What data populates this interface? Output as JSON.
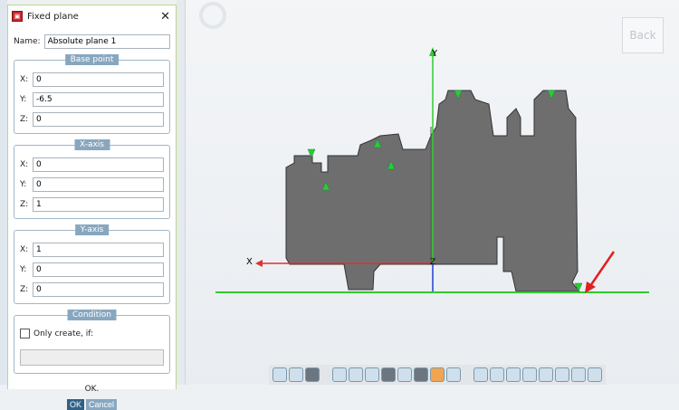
{
  "dialog": {
    "title": "Fixed plane",
    "name_label": "Name:",
    "name_value": "Absolute plane 1",
    "base_point": {
      "legend": "Base point",
      "x": "0",
      "y": "-6.5",
      "z": "0"
    },
    "x_axis": {
      "legend": "X-axis",
      "x": "0",
      "y": "0",
      "z": "1"
    },
    "y_axis": {
      "legend": "Y-axis",
      "x": "1",
      "y": "0",
      "z": "0"
    },
    "condition": {
      "legend": "Condition",
      "checkbox_label": "Only create, if:"
    },
    "status": "OK.",
    "ok": "OK",
    "cancel": "Cancel"
  },
  "labels": {
    "x": "X:",
    "y": "Y:",
    "z": "Z:"
  },
  "viewport": {
    "back": "Back",
    "axis_x": "X",
    "axis_y": "Y",
    "axis_z": "Z"
  },
  "colors": {
    "part": "#6e6e6e",
    "x_axis": "#e03030",
    "y_axis": "#2ecc2e",
    "z_axis": "#2040d0",
    "arrow": "#e02020"
  }
}
